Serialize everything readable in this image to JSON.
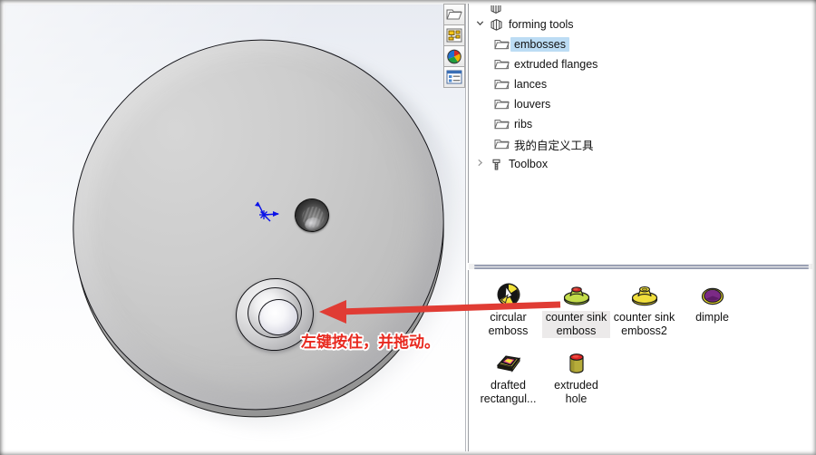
{
  "app": {
    "kind": "cad-sheet-metal-forming-tools",
    "annotation_color": "#e8291f"
  },
  "viewport": {
    "name": "3d-model-viewport",
    "annotation_text": "左键按住，并拖动。",
    "model_description": "circular sheet metal disc",
    "features": [
      "tapped-hole",
      "countersink-emboss",
      "origin-triad"
    ]
  },
  "icon_strip": {
    "buttons": [
      {
        "name": "file-explorer-icon",
        "glyph": "folder"
      },
      {
        "name": "design-library-icon",
        "glyph": "library"
      },
      {
        "name": "3d-content-central-icon",
        "glyph": "globe"
      },
      {
        "name": "custom-properties-icon",
        "glyph": "list"
      }
    ]
  },
  "tree": {
    "name": "design-library-tree",
    "rows": [
      {
        "label": "",
        "icon": "box-icon",
        "indent": 1,
        "chevron": "",
        "partial": true,
        "selected": false
      },
      {
        "label": "forming tools",
        "icon": "box-icon",
        "indent": 1,
        "chevron": "v",
        "partial": false,
        "selected": false
      },
      {
        "label": "embosses",
        "icon": "folder-icon",
        "indent": 2,
        "chevron": "",
        "partial": false,
        "selected": true
      },
      {
        "label": "extruded flanges",
        "icon": "folder-icon",
        "indent": 2,
        "chevron": "",
        "partial": false,
        "selected": false
      },
      {
        "label": "lances",
        "icon": "folder-icon",
        "indent": 2,
        "chevron": "",
        "partial": false,
        "selected": false
      },
      {
        "label": "louvers",
        "icon": "folder-icon",
        "indent": 2,
        "chevron": "",
        "partial": false,
        "selected": false
      },
      {
        "label": "ribs",
        "icon": "folder-icon",
        "indent": 2,
        "chevron": "",
        "partial": false,
        "selected": false
      },
      {
        "label": "我的自定义工具",
        "icon": "folder-icon",
        "indent": 2,
        "chevron": "",
        "partial": false,
        "selected": false
      },
      {
        "label": "Toolbox",
        "icon": "bolt-icon",
        "indent": 1,
        "chevron": ">",
        "partial": false,
        "selected": false
      }
    ]
  },
  "gallery": {
    "name": "forming-tool-gallery",
    "items": [
      {
        "label": "circular emboss",
        "icon": "circular-emboss-icon",
        "highlight": false
      },
      {
        "label": "counter sink emboss",
        "icon": "counter-sink-emboss-icon",
        "highlight": true
      },
      {
        "label": "counter sink emboss2",
        "icon": "counter-sink-emboss2-icon",
        "highlight": false
      },
      {
        "label": "dimple",
        "icon": "dimple-icon",
        "highlight": false
      },
      {
        "label": "drafted rectangul...",
        "icon": "drafted-rectangular-icon",
        "highlight": false
      },
      {
        "label": "extruded hole",
        "icon": "extruded-hole-icon",
        "highlight": false
      }
    ]
  }
}
